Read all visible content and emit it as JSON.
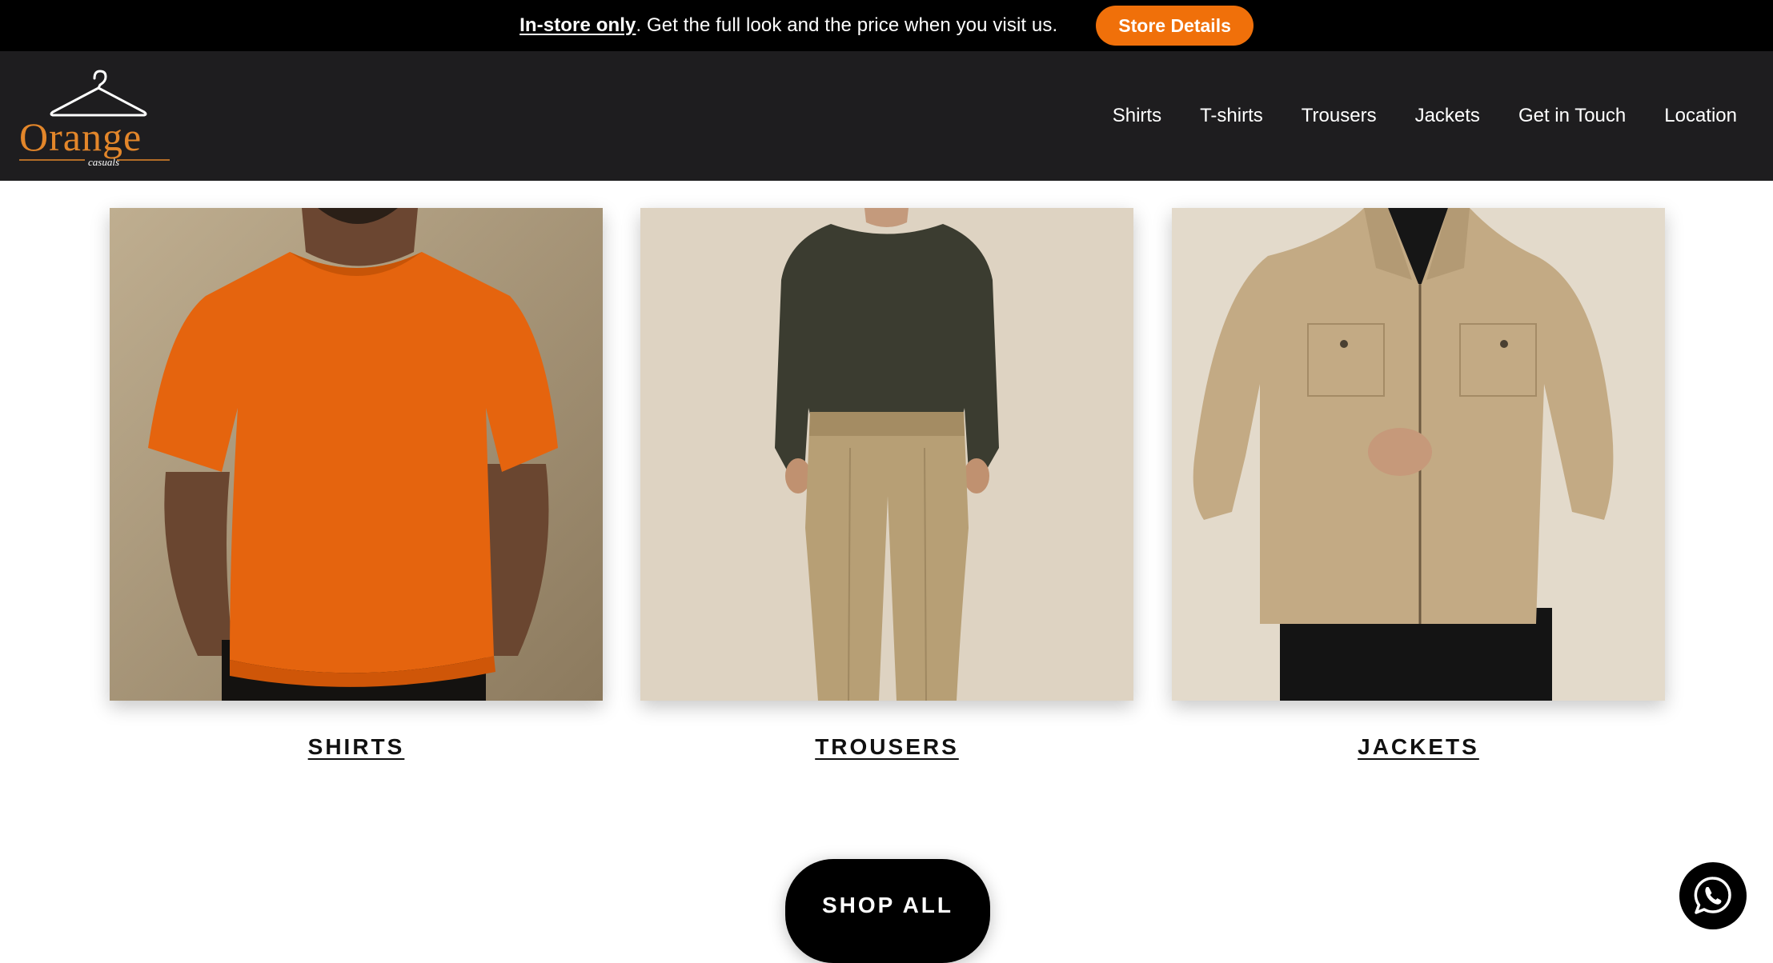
{
  "announcement": {
    "strong": "In-store only",
    "text": ". Get the full look and the price when you visit us.",
    "button_label": "Store Details"
  },
  "brand": {
    "name": "Orange",
    "tagline": "casuals",
    "accent_color": "#f0700a"
  },
  "nav": {
    "items": [
      "Shirts",
      "T-shirts",
      "Trousers",
      "Jackets",
      "Get in Touch",
      "Location"
    ]
  },
  "categories": [
    {
      "label": "SHIRTS",
      "image": "orange t-shirt on model"
    },
    {
      "label": "TROUSERS",
      "image": "khaki trousers with dark sweater"
    },
    {
      "label": "JACKETS",
      "image": "beige zip jacket"
    }
  ],
  "cta": {
    "shop_all": "SHOP ALL"
  },
  "chat": {
    "icon": "whatsapp-icon"
  }
}
